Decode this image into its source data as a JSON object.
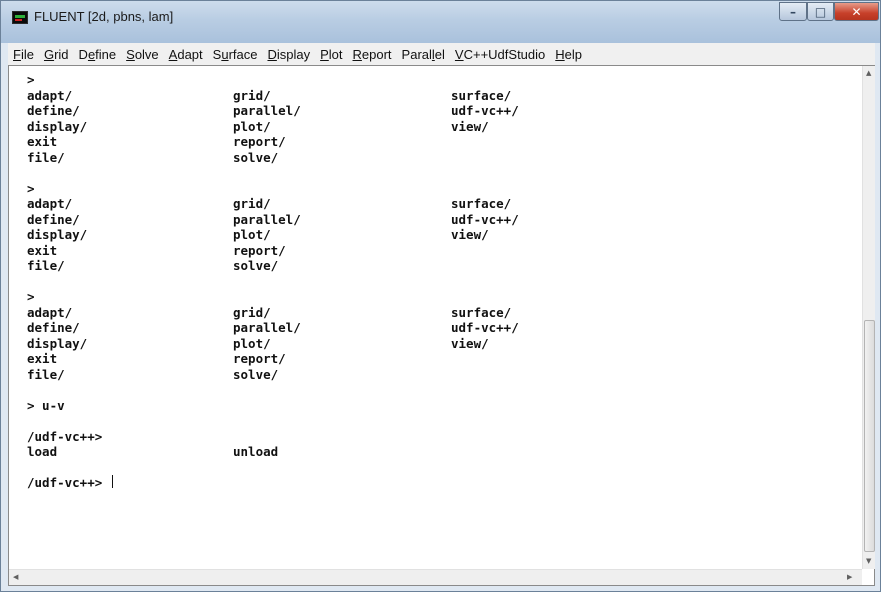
{
  "window": {
    "title": "FLUENT  [2d, pbns, lam]",
    "controls": {
      "minimize": "–",
      "maximize": "□",
      "close": "✕"
    }
  },
  "menu": [
    {
      "label": "File",
      "mnemonic_index": 0
    },
    {
      "label": "Grid",
      "mnemonic_index": 0
    },
    {
      "label": "Define",
      "mnemonic_index": 1
    },
    {
      "label": "Solve",
      "mnemonic_index": 0
    },
    {
      "label": "Adapt",
      "mnemonic_index": 0
    },
    {
      "label": "Surface",
      "mnemonic_index": 1
    },
    {
      "label": "Display",
      "mnemonic_index": 0
    },
    {
      "label": "Plot",
      "mnemonic_index": 0
    },
    {
      "label": "Report",
      "mnemonic_index": 0
    },
    {
      "label": "Parallel",
      "mnemonic_index": 5
    },
    {
      "label": "VC++UdfStudio",
      "mnemonic_index": 0
    },
    {
      "label": "Help",
      "mnemonic_index": 0
    }
  ],
  "console": {
    "lines": [
      [
        ">",
        "",
        ""
      ],
      [
        "adapt/",
        "grid/",
        "surface/"
      ],
      [
        "define/",
        "parallel/",
        "udf-vc++/"
      ],
      [
        "display/",
        "plot/",
        "view/"
      ],
      [
        "exit",
        "report/",
        ""
      ],
      [
        "file/",
        "solve/",
        ""
      ],
      [
        "",
        "",
        ""
      ],
      [
        ">",
        "",
        ""
      ],
      [
        "adapt/",
        "grid/",
        "surface/"
      ],
      [
        "define/",
        "parallel/",
        "udf-vc++/"
      ],
      [
        "display/",
        "plot/",
        "view/"
      ],
      [
        "exit",
        "report/",
        ""
      ],
      [
        "file/",
        "solve/",
        ""
      ],
      [
        "",
        "",
        ""
      ],
      [
        ">",
        "",
        ""
      ],
      [
        "adapt/",
        "grid/",
        "surface/"
      ],
      [
        "define/",
        "parallel/",
        "udf-vc++/"
      ],
      [
        "display/",
        "plot/",
        "view/"
      ],
      [
        "exit",
        "report/",
        ""
      ],
      [
        "file/",
        "solve/",
        ""
      ],
      [
        "",
        "",
        ""
      ],
      [
        "> u-v",
        "",
        ""
      ],
      [
        "",
        "",
        ""
      ],
      [
        "/udf-vc++>",
        "",
        ""
      ],
      [
        "load",
        "unload",
        ""
      ],
      [
        "",
        "",
        ""
      ]
    ],
    "prompt": "/udf-vc++> "
  },
  "colors": {
    "title_bar": "#b9cde3",
    "close_button": "#c7402a",
    "console_bg": "#ffffff",
    "console_text": "#111111"
  }
}
